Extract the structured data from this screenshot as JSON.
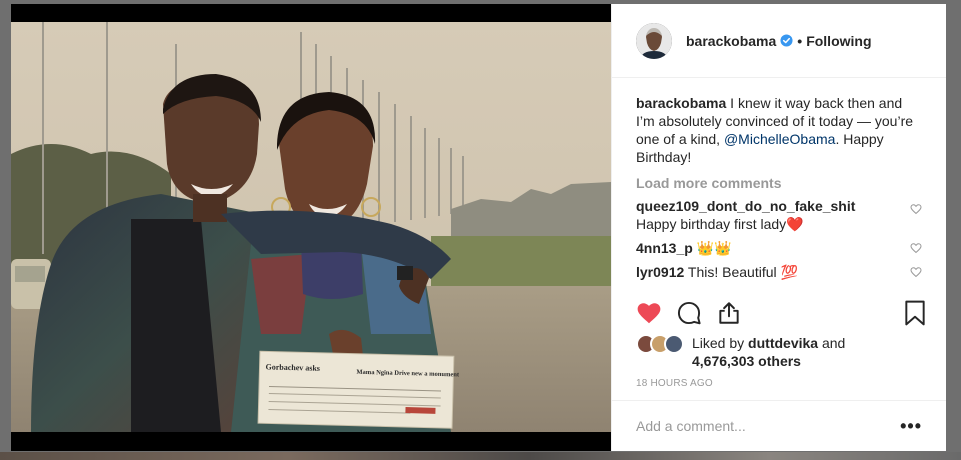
{
  "post": {
    "username": "barackobama",
    "follow_dot": "•",
    "follow_status": "Following",
    "caption_user": "barackobama",
    "caption_text_1": " I knew it way back then and I’m absolutely convinced of it today — you’re one of a kind, ",
    "caption_mention": "@MichelleObama",
    "caption_text_2": ". Happy Birthday!",
    "load_more": "Load more comments",
    "comments": [
      {
        "user": "queez109_dont_do_no_fake_shit",
        "text": "Happy birthday first lady❤️"
      },
      {
        "user": "4nn13_p",
        "text": "👑👑"
      },
      {
        "user": "lyr0912",
        "text": "This! Beautiful 💯"
      }
    ],
    "liked_by_prefix": "Liked by ",
    "liked_by_user": "duttdevika",
    "liked_by_and": " and",
    "likes_count": "4,676,303 others",
    "timestamp": "18 HOURS AGO",
    "add_comment_placeholder": "Add a comment...",
    "more_label": "•••"
  },
  "icons": {
    "like": "heart-filled-icon",
    "comment": "speech-bubble-icon",
    "share": "share-icon",
    "save": "bookmark-icon",
    "verified": "verified-badge-icon"
  },
  "colors": {
    "like_red": "#ed4956",
    "verified_blue": "#3897f0",
    "mention": "#003569",
    "muted": "#999999"
  },
  "newspaper": {
    "headline_left": "Gorbachev asks",
    "headline_right": "Mama Ngina Drive new a monument"
  }
}
